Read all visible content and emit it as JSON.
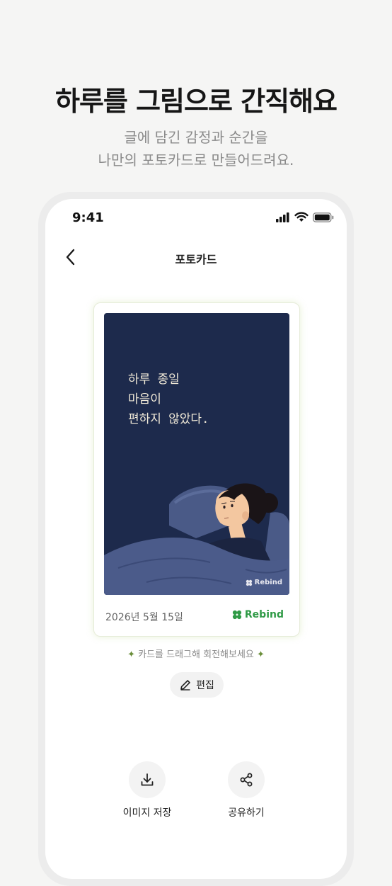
{
  "hero": {
    "title": "하루를 그림으로 간직해요",
    "subtitle_line1": "글에 담긴 감정과 순간을",
    "subtitle_line2": "나만의 포토카드로 만들어드려요."
  },
  "status_bar": {
    "time": "9:41",
    "icons": [
      "signal-icon",
      "wifi-icon",
      "battery-icon"
    ]
  },
  "nav": {
    "back_icon": "chevron-left-icon",
    "title": "포토카드"
  },
  "photocard": {
    "quote_lines": [
      "하루 종일",
      "마음이",
      "편하지 않았다."
    ],
    "image_watermark": "Rebind",
    "date": "2026년 5월 15일",
    "brand": "Rebind",
    "colors": {
      "card_bg": "#1d2a4c",
      "brand": "#2f9a46",
      "quote_text": "#f1ead8"
    }
  },
  "hint": {
    "star_left": "✦",
    "text": "카드를 드래그해 회전해보세요",
    "star_right": "✦"
  },
  "edit_button": {
    "label": "편집",
    "icon": "pencil-icon"
  },
  "actions": [
    {
      "label": "이미지 저장",
      "icon": "download-icon"
    },
    {
      "label": "공유하기",
      "icon": "share-icon"
    }
  ]
}
